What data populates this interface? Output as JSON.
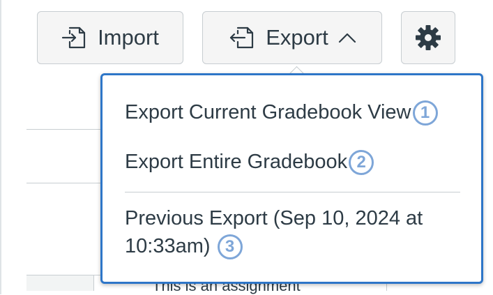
{
  "toolbar": {
    "import_label": "Import",
    "export_label": "Export",
    "import_icon": "import-icon",
    "export_icon": "export-icon",
    "chevron_icon": "chevron-up-icon",
    "settings_icon": "gear-icon"
  },
  "export_menu": {
    "items": [
      {
        "label": "Export Current Gradebook View",
        "badge": "1"
      },
      {
        "label": "Export Entire Gradebook",
        "badge": "2"
      },
      {
        "label": "Previous Export (Sep 10, 2024 at 10:33am)",
        "badge": "3"
      }
    ]
  },
  "background": {
    "row_text": "This is an assignment"
  },
  "colors": {
    "accent_border": "#2e76c8",
    "badge": "#7ea6d8",
    "button_bg": "#f5f5f5",
    "text": "#2d3b45"
  }
}
